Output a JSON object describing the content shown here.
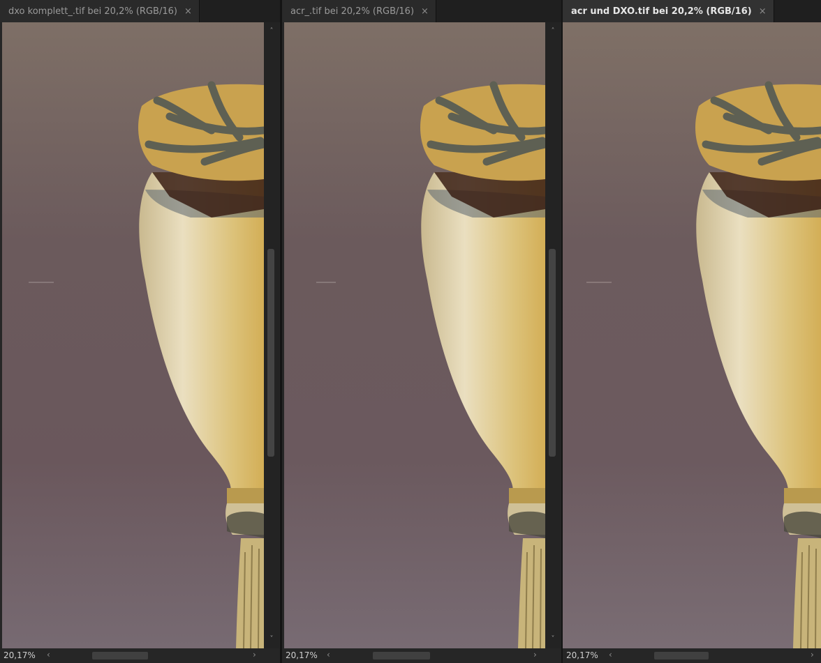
{
  "panels": [
    {
      "title": "dxo komplett_.tif bei 20,2% (RGB/16)",
      "close": "×",
      "zoom": "20,17%",
      "active": false
    },
    {
      "title": "acr_.tif bei 20,2% (RGB/16)",
      "close": "×",
      "zoom": "20,17%",
      "active": false
    },
    {
      "title": "acr und DXO.tif bei 20,2% (RGB/16)",
      "close": "×",
      "zoom": "20,17%",
      "active": true
    }
  ],
  "scroll": {
    "up": "˄",
    "down": "˅",
    "left": "‹",
    "right": "›"
  },
  "colors": {
    "bg_top": "#7d6e67",
    "bg_bottom": "#6e5e64",
    "pod_light": "#ece1c4",
    "pod_yellow": "#d8b966",
    "crown": "#6f6a55"
  }
}
